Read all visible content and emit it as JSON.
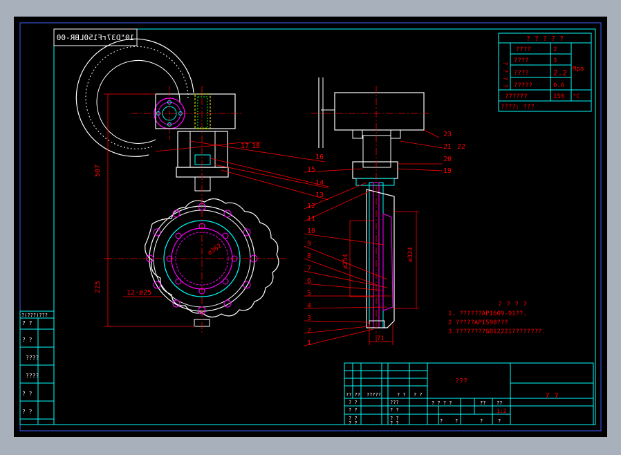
{
  "drawing": {
    "code_mirrored": "10\"D37rF150LBR-00",
    "dimensions": {
      "height_top": "507",
      "height_bottom": "225",
      "bolt_holes": "12-ø25",
      "bolt_circle": "ø362",
      "disc_thickness": "71",
      "flange_inner": "ø324",
      "flange_pcd": "ø254"
    },
    "part_numbers_left": [
      "17",
      "18",
      "16",
      "14",
      "13"
    ],
    "part_numbers_right": [
      "23",
      "21",
      "22",
      "20",
      "15",
      "19",
      "12",
      "11",
      "10",
      "9",
      "8",
      "7",
      "6",
      "5",
      "4",
      "3",
      "2",
      "1"
    ]
  },
  "spec_table": {
    "title": "? ? ? ? ?",
    "group_label": "? ? ? ?",
    "rows": [
      {
        "label": "????",
        "value": "2"
      },
      {
        "label": "????",
        "value": "3"
      },
      {
        "label": "????",
        "value": "2.2"
      },
      {
        "label": "?????",
        "value": "0.6"
      },
      {
        "label": "??????",
        "value": "150"
      }
    ],
    "unit_pressure": "Mpa",
    "unit_temp": "°C",
    "footer": "????:  ???"
  },
  "notes": {
    "title": "? ? ? ?",
    "lines": [
      "1. ??????API609-91??.",
      "2  ?????API598???",
      "3.????????GB12221????????."
    ]
  },
  "side_table": {
    "header": "?(???)???",
    "rows": [
      "?  ?",
      "?  ?",
      "????",
      "????",
      "?  ?",
      "?  ?"
    ]
  },
  "title_block": {
    "name": "???",
    "company": "?  ?",
    "col_headers": [
      "?? ??",
      "?????",
      "? ?",
      "? ?"
    ],
    "left_cells": [
      "? ?",
      "? ?",
      "? ?",
      "? ?"
    ],
    "mid_cells": [
      "???",
      "? ?",
      "? ?",
      "? ?"
    ],
    "stage": "? ? ? ?",
    "weight": "??",
    "scale_label": "??",
    "scale": "1:2",
    "sheet": [
      "?",
      "?",
      "?",
      "?"
    ]
  },
  "colors": {
    "cyan": "#00ffff",
    "red": "#ff0000",
    "magenta": "#ff00ff",
    "white": "#ffffff",
    "yellow": "#ffff00",
    "green": "#00ff00",
    "frame_blue": "#4060ff"
  }
}
